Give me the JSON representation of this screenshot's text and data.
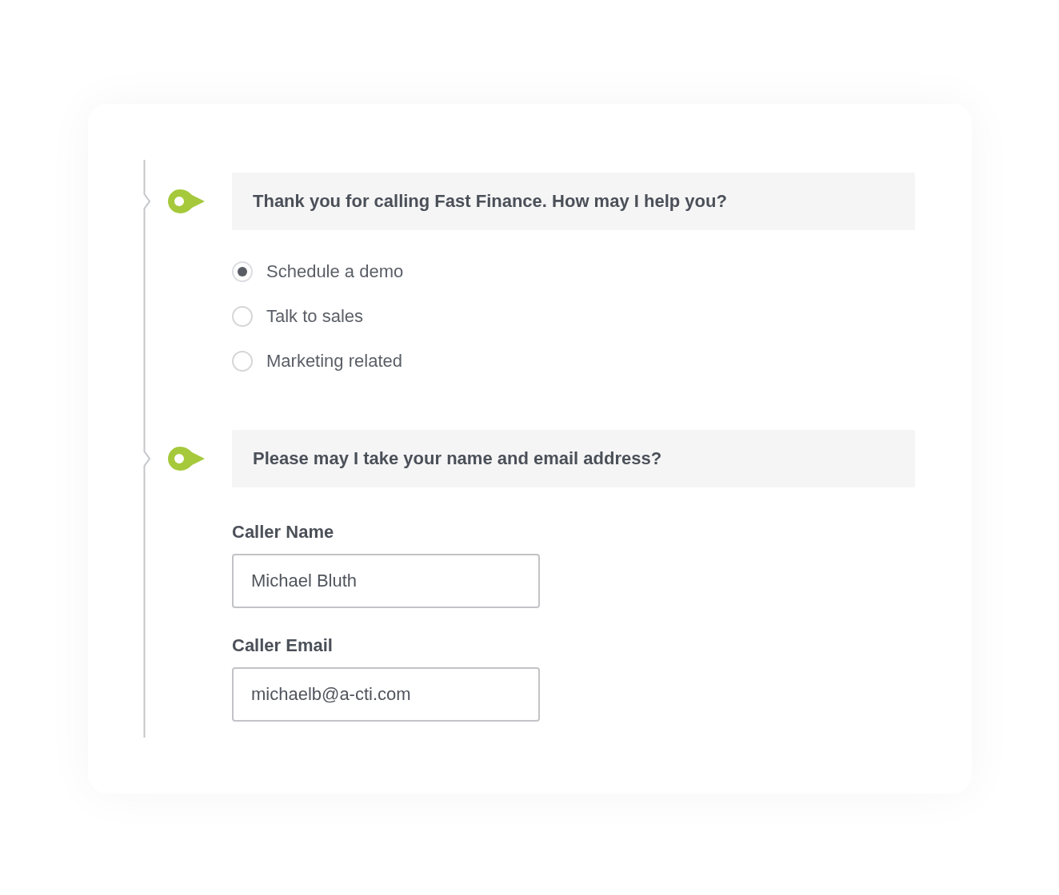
{
  "steps": [
    {
      "kind": "choice",
      "question": "Thank you for calling Fast Finance. How may I help you?",
      "options": [
        {
          "label": "Schedule a demo",
          "selected": true
        },
        {
          "label": "Talk to sales",
          "selected": false
        },
        {
          "label": "Marketing related",
          "selected": false
        }
      ]
    },
    {
      "kind": "fields",
      "question": "Please may I take your name and email address?",
      "fields": [
        {
          "label": "Caller Name",
          "value": "Michael Bluth"
        },
        {
          "label": "Caller Email",
          "value": "michaelb@a-cti.com"
        }
      ]
    }
  ]
}
